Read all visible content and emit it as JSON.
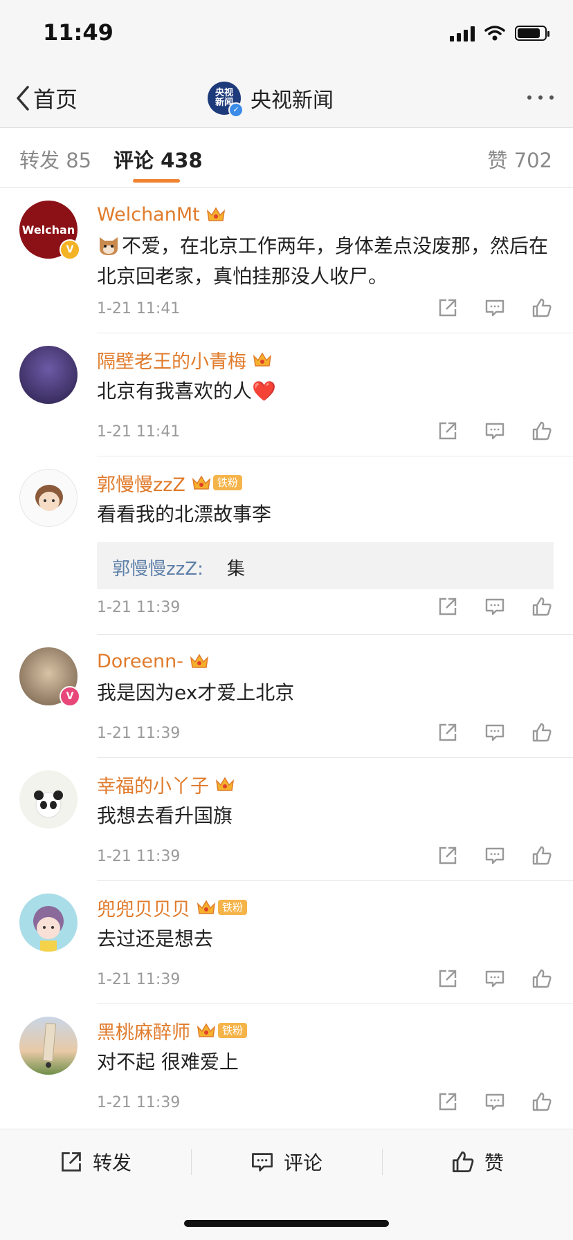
{
  "status": {
    "time": "11:49"
  },
  "nav": {
    "back_label": "首页",
    "title": "央视新闻",
    "logo_text": "央视新闻"
  },
  "tabs": {
    "repost": "转发 85",
    "comment": "评论 438",
    "like": "赞 702"
  },
  "comments": [
    {
      "username": "WelchanMt",
      "text": "不爱，在北京工作两年，身体差点没废那，然后在北京回老家，真怕挂那没人收尸。",
      "time": "1-21 11:41",
      "avatar_text": "Welchan",
      "emoji": "cat-face-emoji"
    },
    {
      "username": "隔壁老王的小青梅",
      "text": "北京有我喜欢的人❤️",
      "time": "1-21 11:41"
    },
    {
      "username": "郭慢慢zzZ",
      "fan_badge": "铁粉",
      "text": "看看我的北漂故事李",
      "reply": {
        "name": "郭慢慢zzZ:",
        "text": "集"
      },
      "time": "1-21 11:39"
    },
    {
      "username": "Doreenn-",
      "text": "我是因为ex才爱上北京",
      "time": "1-21 11:39"
    },
    {
      "username": "幸福的小丫子",
      "text": "我想去看升国旗",
      "time": "1-21 11:39"
    },
    {
      "username": "兜兜贝贝贝",
      "fan_badge": "铁粉",
      "text": "去过还是想去",
      "time": "1-21 11:39"
    },
    {
      "username": "黑桃麻醉师",
      "fan_badge": "铁粉",
      "text": "对不起 很难爱上",
      "time": "1-21 11:39"
    }
  ],
  "bottom": {
    "repost": "转发",
    "comment": "评论",
    "like": "赞"
  },
  "colors": {
    "accent": "#f08332",
    "username": "#e07b2c",
    "reply_name": "#5e7fa8"
  }
}
